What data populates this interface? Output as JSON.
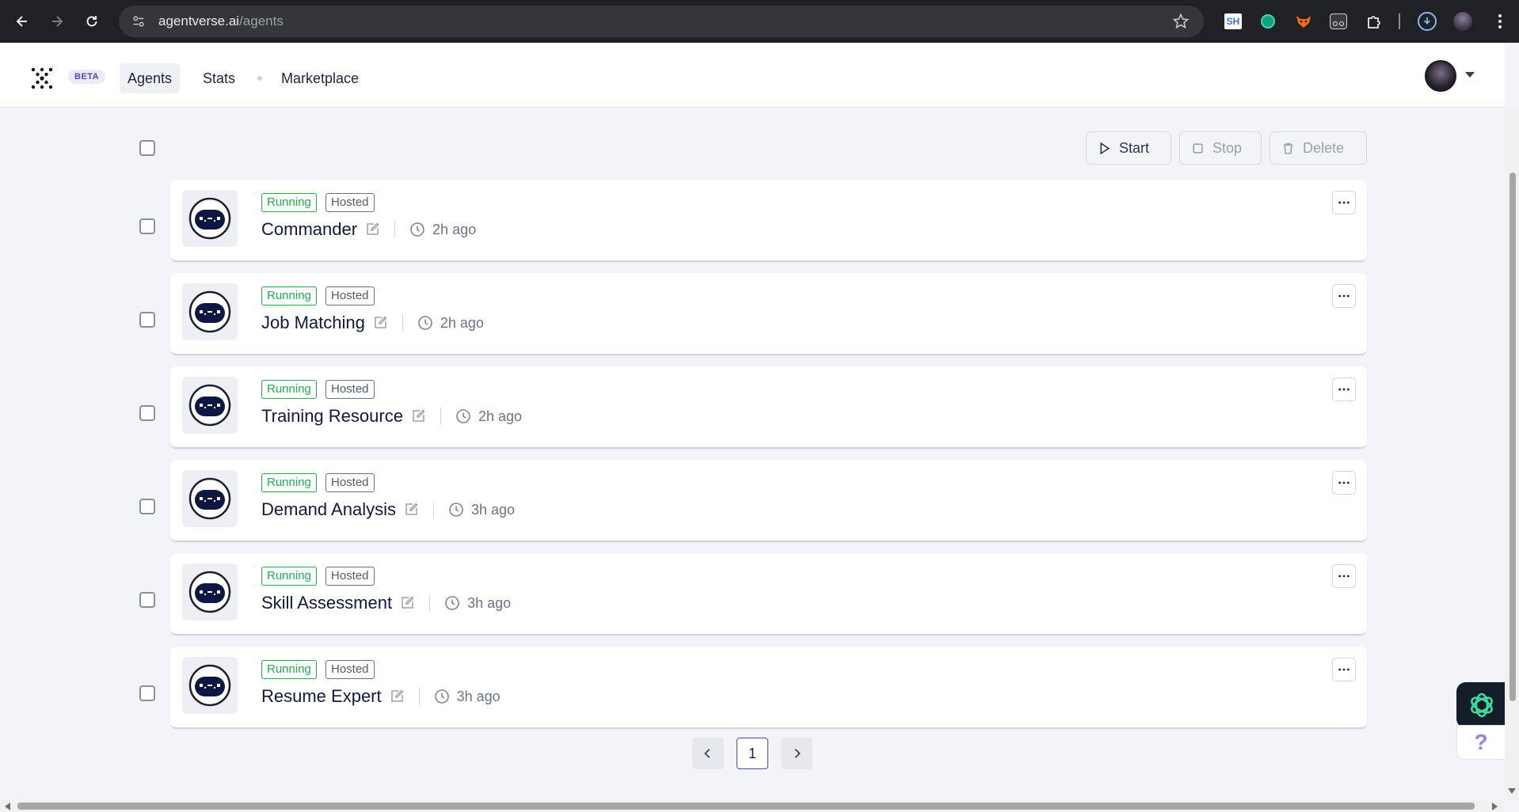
{
  "browser": {
    "url_domain": "agentverse.ai",
    "url_path": "/agents",
    "extensions": [
      "sh-extension-icon",
      "chatgpt-extension-icon",
      "fox-extension-icon",
      "glasses-extension-icon",
      "puzzle-extensions-icon",
      "download-icon",
      "profile-icon",
      "kebab-menu-icon"
    ]
  },
  "header": {
    "beta_label": "BETA",
    "nav": {
      "agents": "Agents",
      "stats": "Stats",
      "marketplace": "Marketplace"
    }
  },
  "toolbar": {
    "start_label": "Start",
    "stop_label": "Stop",
    "delete_label": "Delete"
  },
  "agents": [
    {
      "name": "Commander",
      "status": "Running",
      "hosting": "Hosted",
      "time": "2h ago"
    },
    {
      "name": "Job Matching",
      "status": "Running",
      "hosting": "Hosted",
      "time": "2h ago"
    },
    {
      "name": "Training Resource",
      "status": "Running",
      "hosting": "Hosted",
      "time": "2h ago"
    },
    {
      "name": "Demand Analysis",
      "status": "Running",
      "hosting": "Hosted",
      "time": "3h ago"
    },
    {
      "name": "Skill Assessment",
      "status": "Running",
      "hosting": "Hosted",
      "time": "3h ago"
    },
    {
      "name": "Resume Expert",
      "status": "Running",
      "hosting": "Hosted",
      "time": "3h ago"
    }
  ],
  "pagination": {
    "current_page": "1"
  },
  "help_label": "?",
  "colors": {
    "running": "#1fae4f",
    "accent": "#4a46b8",
    "bot_face": "#0c1742"
  }
}
